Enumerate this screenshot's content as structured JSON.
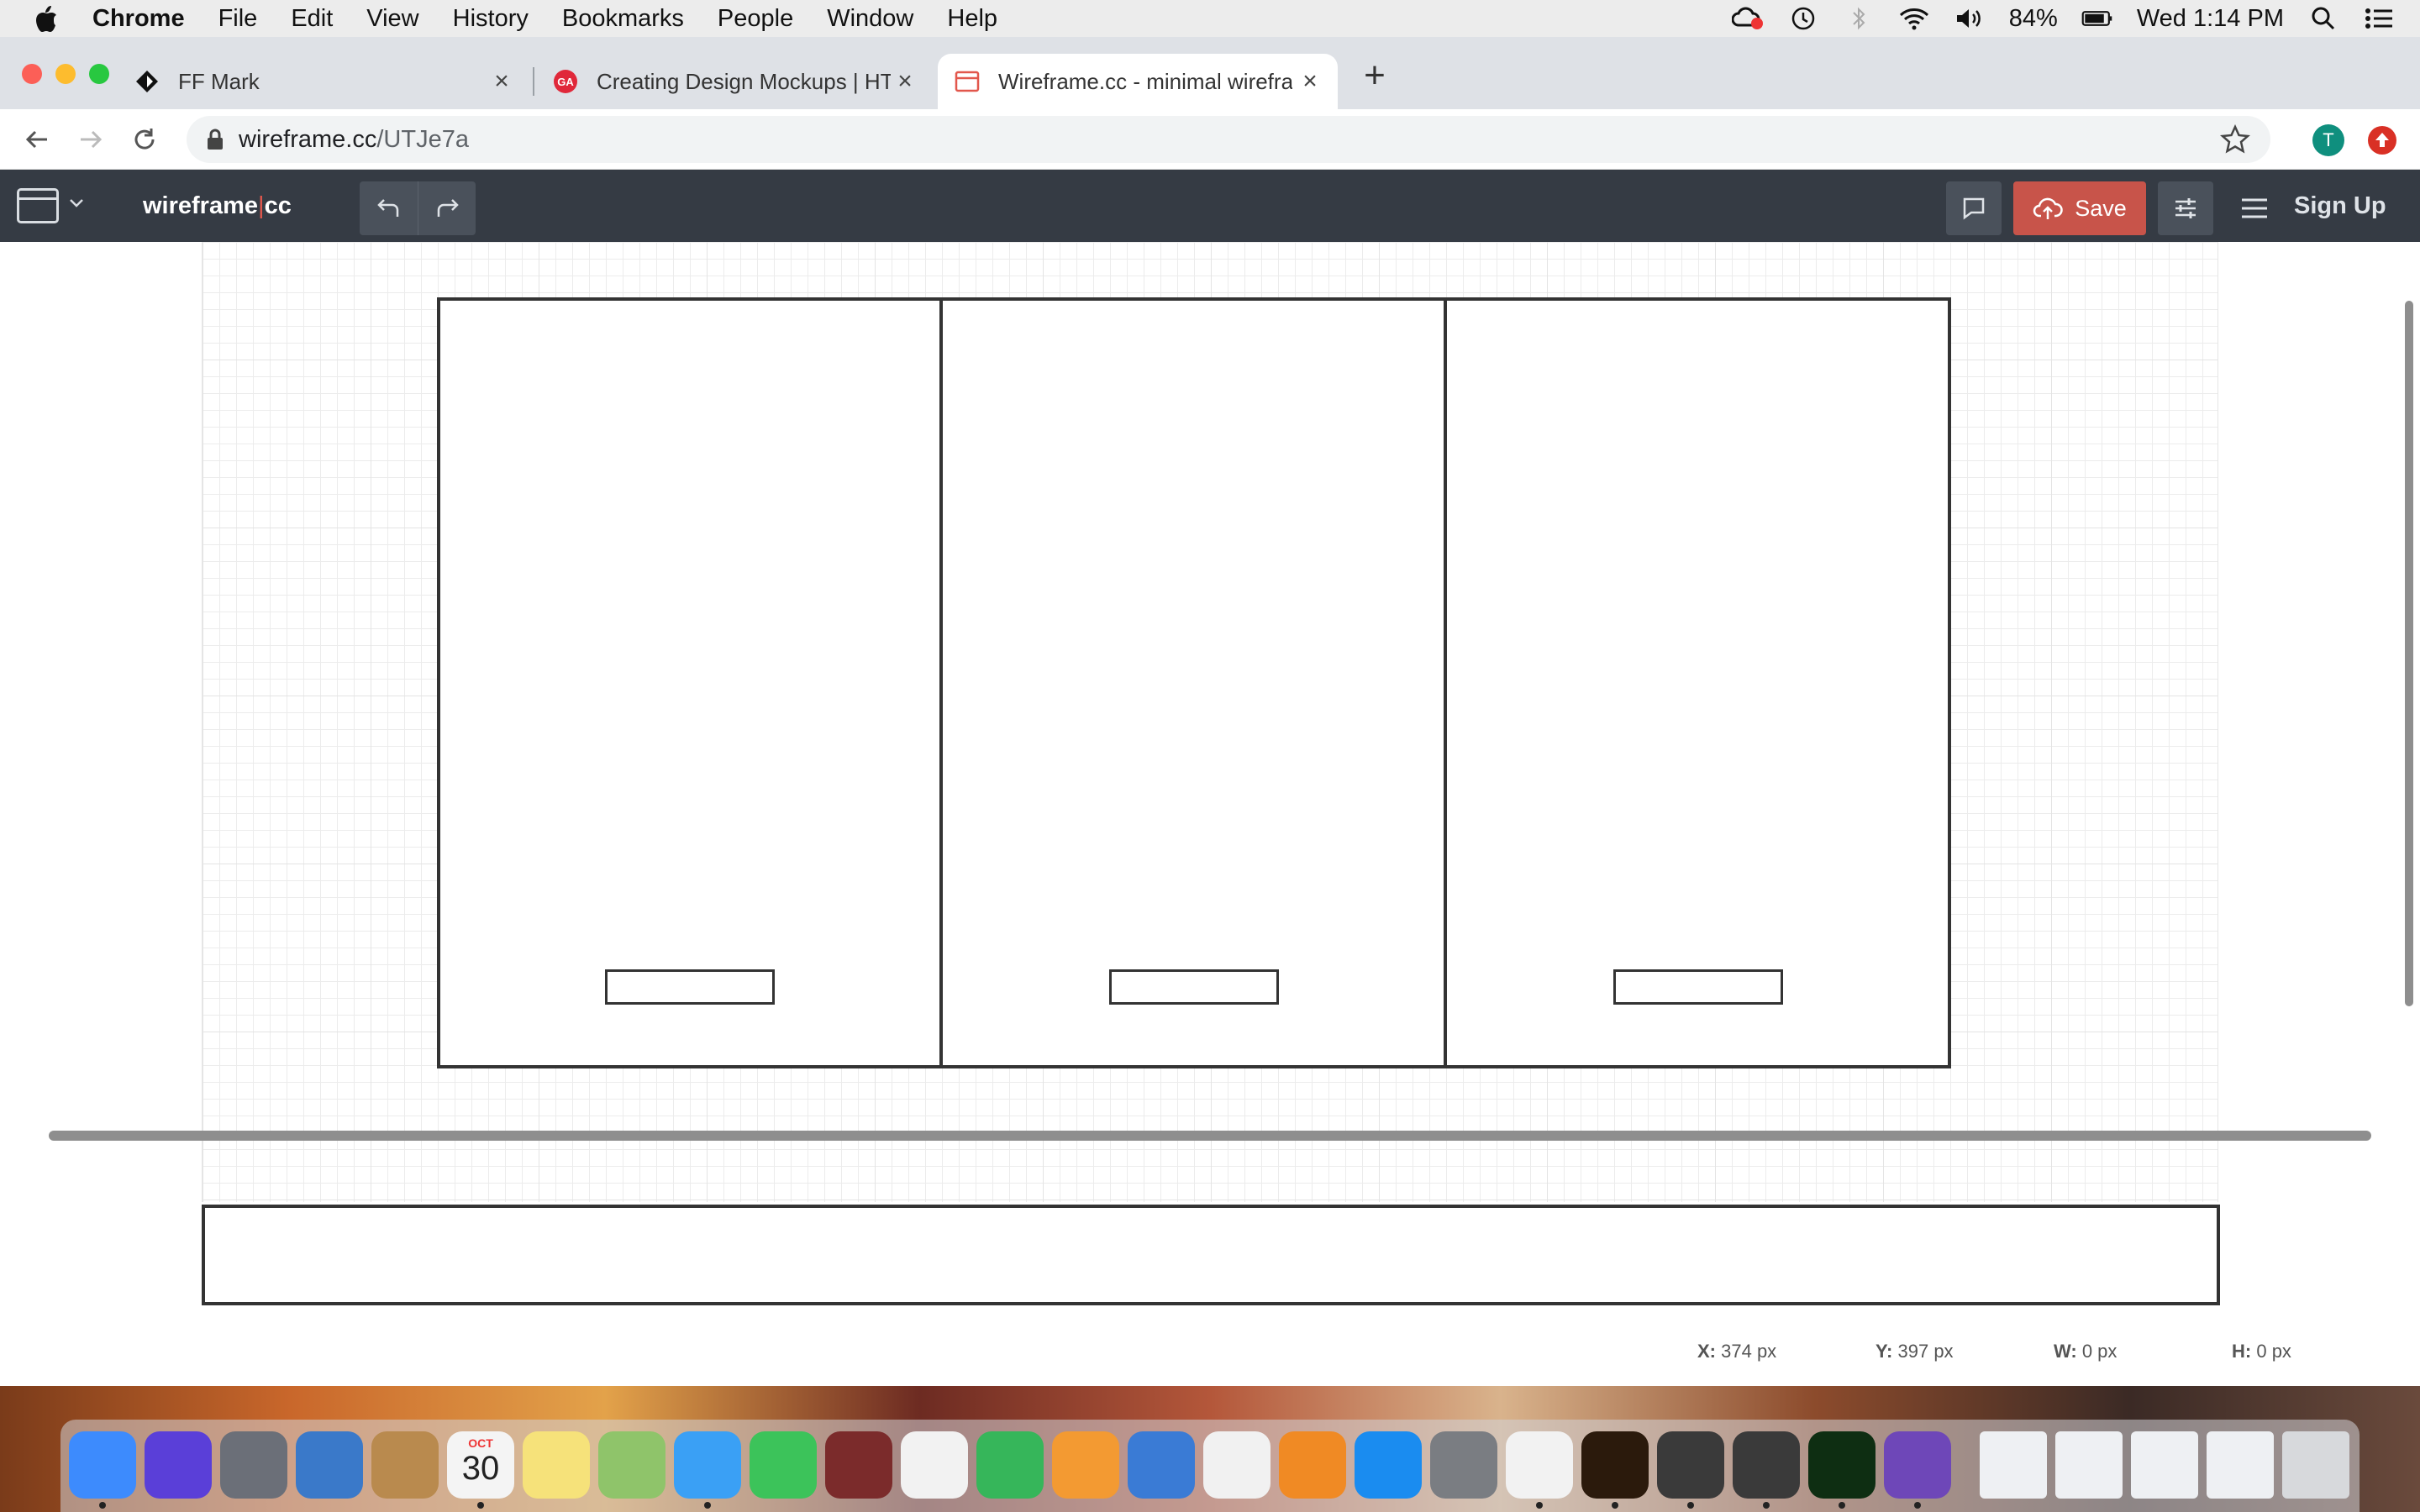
{
  "menubar": {
    "app": "Chrome",
    "items": [
      "File",
      "Edit",
      "View",
      "History",
      "Bookmarks",
      "People",
      "Window",
      "Help"
    ],
    "battery": "84%",
    "clock": "Wed 1:14 PM"
  },
  "tabs": [
    {
      "title": "FF Mark",
      "close": "×"
    },
    {
      "title": "Creating Design Mockups | HT",
      "close": "×"
    },
    {
      "title": "Wireframe.cc - minimal wirefra",
      "close": "×"
    }
  ],
  "new_tab": "+",
  "address": {
    "domain": "wireframe.cc",
    "path": "/UTJe7a"
  },
  "profile_initial": "T",
  "app": {
    "logo_left": "wireframe",
    "logo_sep": "|",
    "logo_right": "cc",
    "save_label": "Save",
    "signup_label": "Sign Up"
  },
  "status": {
    "x_label": "X:",
    "x_value": "374 px",
    "y_label": "Y:",
    "y_value": "397 px",
    "w_label": "W:",
    "w_value": "0 px",
    "h_label": "H:",
    "h_value": "0 px"
  },
  "colors": {
    "header_bg": "#353b44",
    "save_bg": "#c8544a",
    "accent": "#e2574c"
  },
  "dock_icons": [
    "finder-icon",
    "siri-icon",
    "launchpad-icon",
    "mail-icon",
    "contacts-icon",
    "calendar-icon",
    "notes-icon",
    "maps-icon",
    "messages-icon",
    "facetime-icon",
    "photo-booth-icon",
    "photos-icon",
    "numbers-icon",
    "pages-icon",
    "keynote-icon",
    "itunes-icon",
    "books-icon",
    "app-store-icon",
    "system-preferences-icon",
    "chrome-icon",
    "illustrator-icon",
    "sublime-icon",
    "sublime-icon-2",
    "dreamweaver-icon",
    "github-icon"
  ],
  "calendar": {
    "month": "OCT",
    "day": "30"
  }
}
